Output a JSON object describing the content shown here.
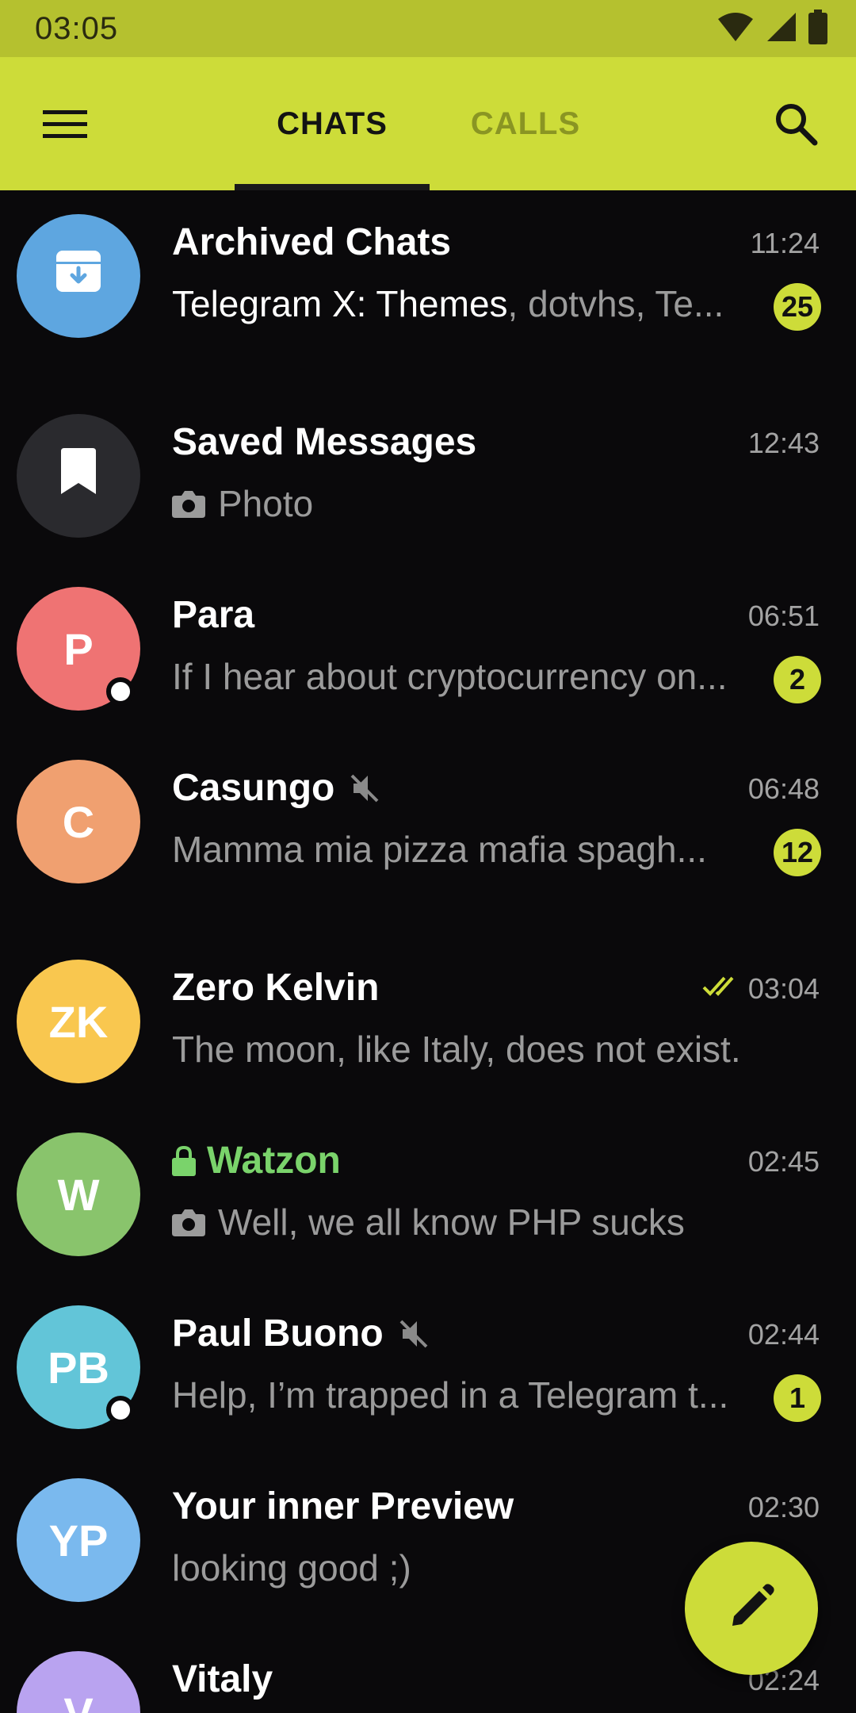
{
  "status_bar": {
    "time": "03:05",
    "icons": [
      "wifi-icon",
      "signal-icon",
      "battery-icon"
    ]
  },
  "app_bar": {
    "menu_icon": "menu-icon",
    "tabs": [
      {
        "label": "CHATS",
        "active": true
      },
      {
        "label": "CALLS",
        "active": false
      }
    ],
    "search_icon": "search-icon"
  },
  "colors": {
    "accent": "#cddc39",
    "status_bar": "#b5c12f",
    "background": "#0a090b",
    "secret_chat_title": "#7ad36b"
  },
  "chats": [
    {
      "title": "Archived Chats",
      "time": "11:24",
      "preview_sender": "Telegram X: Themes",
      "preview": ", dotvhs, Te...",
      "badge": "25",
      "avatar_icon": "archive-icon",
      "avatar_color": "#5ea6e0"
    },
    {
      "title": "Saved Messages",
      "time": "12:43",
      "preview": "Photo",
      "preview_icon": "camera-icon",
      "avatar_icon": "bookmark-icon",
      "avatar_color": "#2a2a2e"
    },
    {
      "title": "Para",
      "time": "06:51",
      "preview": "If I hear about cryptocurrency on...",
      "badge": "2",
      "avatar_initials": "P",
      "avatar_color": "#ef7373",
      "online": true
    },
    {
      "title": "Casungo",
      "time": "06:48",
      "preview": "Mamma mia pizza mafia spagh...",
      "badge": "12",
      "avatar_initials": "C",
      "avatar_color": "#f0a070",
      "muted": true
    },
    {
      "title": "Zero Kelvin",
      "time": "03:04",
      "preview": "The moon, like Italy, does not exist.",
      "avatar_initials": "ZK",
      "avatar_color": "#f9c74f",
      "read_icon": "double-check-icon"
    },
    {
      "title": "Watzon",
      "time": "02:45",
      "preview": "Well, we all know PHP sucks",
      "preview_icon": "camera-icon",
      "avatar_initials": "W",
      "avatar_color": "#89c46c",
      "secret": true
    },
    {
      "title": "Paul Buono",
      "time": "02:44",
      "preview": "Help, I’m trapped in a Telegram t...",
      "badge": "1",
      "avatar_initials": "PB",
      "avatar_color": "#62c5d8",
      "online": true,
      "muted": true
    },
    {
      "title": "Your inner Preview",
      "time": "02:30",
      "preview": "looking good ;)",
      "avatar_initials": "YP",
      "avatar_color": "#7ab9ee"
    },
    {
      "title": "Vitaly",
      "time": "02:24",
      "preview": "",
      "avatar_initials": "V",
      "avatar_color": "#b9a3f0"
    }
  ],
  "fab": {
    "icon": "pencil-icon"
  }
}
